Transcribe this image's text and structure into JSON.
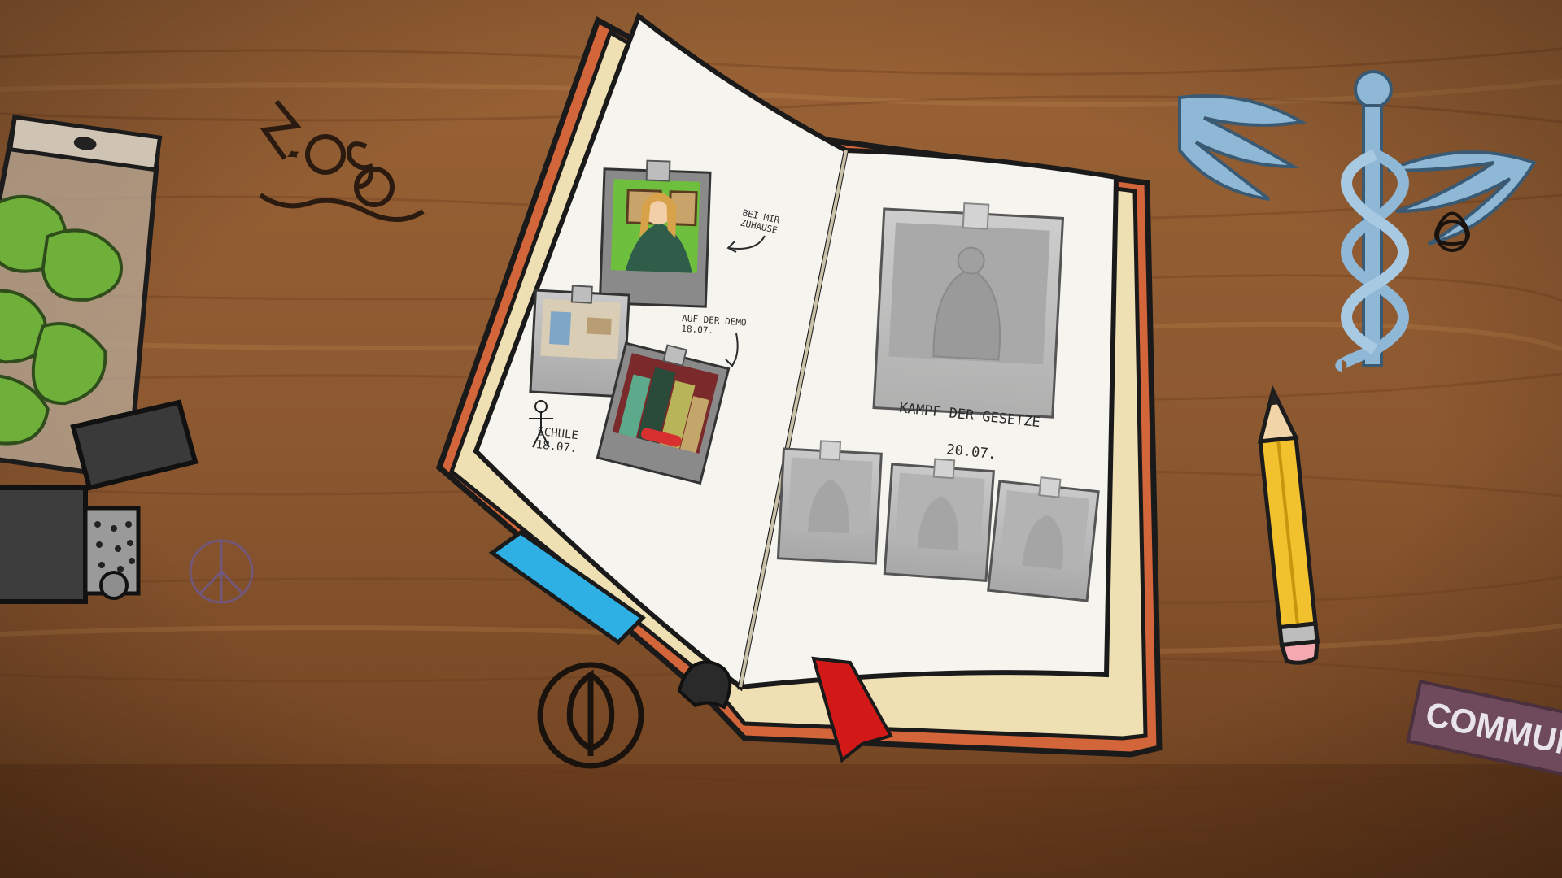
{
  "scene": {
    "name": "diary-desk",
    "colors": {
      "wood_dark": "#5a3418",
      "wood_mid": "#8a5a32",
      "wood_light": "#a9713f",
      "page": "#f6f4ee",
      "page_edge": "#efe0b3",
      "cover": "#d2663a",
      "caduceus": "#8fb7d6",
      "pencil": "#f2c12e",
      "tab_blue": "#2fb0e5",
      "ribbon_red": "#d31818"
    }
  },
  "diary": {
    "left_page": {
      "photos": [
        {
          "id": "home",
          "caption": "BEI MIR\nZUHAUSE",
          "state": "unlocked"
        },
        {
          "id": "school",
          "caption": "SCHULE\n18.07.",
          "state": "locked"
        },
        {
          "id": "demo",
          "caption": "AUF DER DEMO\n18.07.",
          "state": "unlocked"
        }
      ]
    },
    "right_page": {
      "main_photo": {
        "id": "kampf",
        "state": "locked"
      },
      "heading": "KAMPF DER GESETZE",
      "date": "20.07.",
      "small_photos": [
        {
          "id": "statue-1",
          "state": "locked"
        },
        {
          "id": "statue-2",
          "state": "locked"
        },
        {
          "id": "statue-3",
          "state": "locked"
        }
      ]
    }
  },
  "desk_items": {
    "zoso_symbol": "ZOSO",
    "sticker_text": "COMMUN",
    "icons": [
      "herb-bag-icon",
      "lighter-icon",
      "zoso-icon",
      "peace-icon",
      "feather-emblem-icon",
      "caduceus-icon",
      "triquetra-icon",
      "pencil-icon"
    ]
  }
}
